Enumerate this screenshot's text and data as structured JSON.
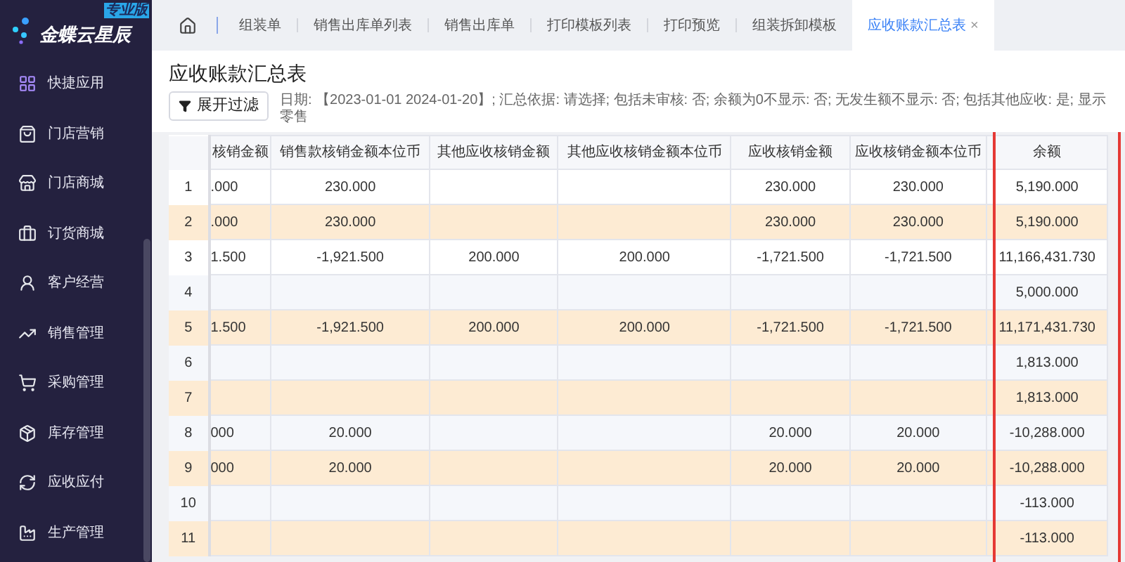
{
  "logo": {
    "name": "金蝶云星辰",
    "badge": "专业版"
  },
  "sidebar": {
    "items": [
      {
        "label": "快捷应用",
        "kind": "apps"
      },
      {
        "label": "门店营销",
        "kind": "bag"
      },
      {
        "label": "门店商城",
        "kind": "store"
      },
      {
        "label": "订货商城",
        "kind": "cart-bag"
      },
      {
        "label": "客户经营",
        "kind": "user"
      },
      {
        "label": "销售管理",
        "kind": "chart"
      },
      {
        "label": "采购管理",
        "kind": "cart"
      },
      {
        "label": "库存管理",
        "kind": "box"
      },
      {
        "label": "应收应付",
        "kind": "cycle"
      },
      {
        "label": "生产管理",
        "kind": "factory"
      }
    ]
  },
  "tabs": [
    {
      "label": "组装单",
      "selected": false
    },
    {
      "label": "销售出库单列表",
      "selected": false
    },
    {
      "label": "销售出库单",
      "selected": false
    },
    {
      "label": "打印模板列表",
      "selected": false
    },
    {
      "label": "打印预览",
      "selected": false
    },
    {
      "label": "组装拆卸模板",
      "selected": false
    },
    {
      "label": "应收账款汇总表",
      "selected": true,
      "close": "×"
    }
  ],
  "page": {
    "title": "应收账款汇总表",
    "filter_button": "展开过滤",
    "filter_summary": "日期: 【2023-01-01 2024-01-20】; 汇总依据: 请选择; 包括未审核: 否; 余额为0不显示: 否; 无发生额不显示: 否; 包括其他应收: 是; 显示零售"
  },
  "table": {
    "columns": [
      {
        "label": "核销金额",
        "marked": false
      },
      {
        "label": "销售款核销金额本位币",
        "marked": false
      },
      {
        "label": "其他应收核销金额",
        "marked": false
      },
      {
        "label": "其他应收核销金额本位币",
        "marked": false
      },
      {
        "label": "应收核销金额",
        "marked": false
      },
      {
        "label": "应收核销金额本位币",
        "marked": false
      },
      {
        "label": "余额",
        "marked": true
      }
    ],
    "rows": [
      {
        "no": "1",
        "highlighted": false,
        "cells": [
          ".000",
          "230.000",
          null,
          null,
          "230.000",
          "230.000",
          "5,190.000"
        ]
      },
      {
        "no": "2",
        "highlighted": true,
        "cells": [
          ".000",
          "230.000",
          null,
          null,
          "230.000",
          "230.000",
          "5,190.000"
        ]
      },
      {
        "no": "3",
        "highlighted": false,
        "cells": [
          "1.500",
          "-1,921.500",
          "200.000",
          "200.000",
          "-1,721.500",
          "-1,721.500",
          "11,166,431.730"
        ]
      },
      {
        "no": "4",
        "highlighted": false,
        "cells": [
          null,
          null,
          null,
          null,
          null,
          null,
          "5,000.000"
        ]
      },
      {
        "no": "5",
        "highlighted": true,
        "cells": [
          "1.500",
          "-1,921.500",
          "200.000",
          "200.000",
          "-1,721.500",
          "-1,721.500",
          "11,171,431.730"
        ]
      },
      {
        "no": "6",
        "highlighted": false,
        "cells": [
          null,
          null,
          null,
          null,
          null,
          null,
          "1,813.000"
        ]
      },
      {
        "no": "7",
        "highlighted": true,
        "cells": [
          null,
          null,
          null,
          null,
          null,
          null,
          "1,813.000"
        ]
      },
      {
        "no": "8",
        "highlighted": false,
        "cells": [
          "000",
          "20.000",
          null,
          null,
          "20.000",
          "20.000",
          "-10,288.000"
        ]
      },
      {
        "no": "9",
        "highlighted": true,
        "cells": [
          "000",
          "20.000",
          null,
          null,
          "20.000",
          "20.000",
          "-10,288.000"
        ]
      },
      {
        "no": "10",
        "highlighted": false,
        "cells": [
          null,
          null,
          null,
          null,
          null,
          null,
          "-113.000"
        ]
      },
      {
        "no": "11",
        "highlighted": true,
        "cells": [
          null,
          null,
          null,
          null,
          null,
          null,
          "-113.000"
        ]
      }
    ]
  }
}
